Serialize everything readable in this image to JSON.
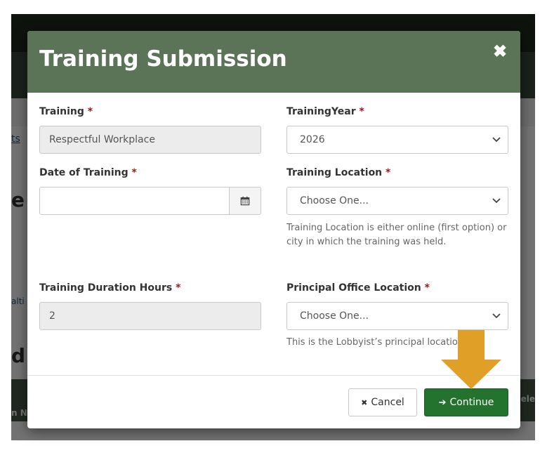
{
  "background": {
    "link_text": "ts",
    "heading_partial": "e",
    "small_text": "alti",
    "heading2_partial": "d A",
    "table_header_left": "n N",
    "table_header_right": "ele"
  },
  "modal": {
    "title": "Training Submission",
    "close_glyph": "✖",
    "required_marker": "*",
    "fields": {
      "training": {
        "label": "Training",
        "value": "Respectful Workplace"
      },
      "training_year": {
        "label": "TrainingYear",
        "value": "2026"
      },
      "date_of_training": {
        "label": "Date of Training",
        "value": ""
      },
      "training_location": {
        "label": "Training Location",
        "value": "Choose One...",
        "help": "Training Location is either online (first option) or city in which the training was held."
      },
      "duration_hours": {
        "label": "Training Duration Hours",
        "value": "2"
      },
      "principal_office_location": {
        "label": "Principal Office Location",
        "value": "Choose One...",
        "help": "This is the Lobbyist’s principal location."
      }
    },
    "buttons": {
      "cancel_icon": "✖",
      "cancel_label": "Cancel",
      "continue_icon": "➔",
      "continue_label": "Continue"
    }
  },
  "colors": {
    "header": "#5b7357",
    "continue": "#23732f",
    "arrow": "#e0a028",
    "required": "#a01818"
  },
  "icons": {
    "calendar": "calendar-icon",
    "chevron": "chevron-down-icon",
    "close": "close-icon",
    "arrow": "down-arrow-annotation"
  }
}
